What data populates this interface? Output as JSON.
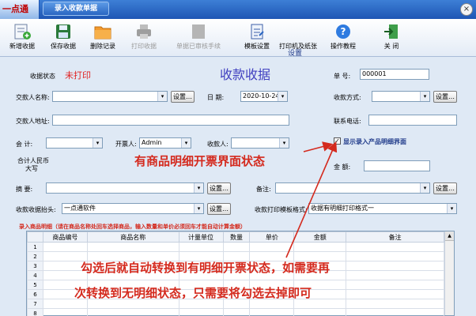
{
  "window": {
    "logo_text": "一点通",
    "title": "录入收款单据",
    "close_glyph": "×"
  },
  "toolbar": {
    "top_label": "设置",
    "buttons": [
      {
        "label": "新增收据",
        "icon": "new-receipt-icon",
        "enabled": true
      },
      {
        "label": "保存收据",
        "icon": "save-icon",
        "enabled": true
      },
      {
        "label": "删除记录",
        "icon": "delete-folder-icon",
        "enabled": true
      },
      {
        "label": "打印收据",
        "icon": "printer-icon",
        "enabled": false
      },
      {
        "label": "单据已审核手续",
        "icon": "audit-icon",
        "enabled": false
      },
      {
        "label": "模板设置",
        "icon": "template-icon",
        "enabled": true
      },
      {
        "label": "打印机及纸张",
        "icon": "printer-settings-icon",
        "enabled": true
      },
      {
        "label": "操作教程",
        "icon": "help-icon",
        "enabled": true
      },
      {
        "label": "关 闭",
        "icon": "exit-icon",
        "enabled": true
      }
    ]
  },
  "form": {
    "title": "收款收据",
    "status_label": "收据状态",
    "status_value": "未打印",
    "number_label": "单    号:",
    "number_value": "000001",
    "payer_label": "交款人名称:",
    "payer_value": "",
    "date_label": "日    期:",
    "date_value": "2020-10-24",
    "pay_method_label": "收款方式:",
    "pay_method_value": "",
    "payer_address_label": "交款人地址:",
    "payer_address_value": "",
    "phone_label": "联系电话:",
    "phone_value": "",
    "accountant_label": "会     计:",
    "accountant_value": "",
    "issuer_label": "开票人:",
    "issuer_value": "Admin",
    "receiver_label": "收款人:",
    "receiver_value": "",
    "show_detail_label": "显示录入产品明细界面",
    "show_detail_checked": true,
    "total_label_line1": "合计人民币",
    "total_label_line2": "大写",
    "amount_label": "金    额:",
    "amount_value": "",
    "summary_label": "摘     要:",
    "summary_value": "",
    "remark_label": "备注:",
    "remark_value": "",
    "receipt_header_label": "收款收据抬头:",
    "receipt_header_value": "一点通软件",
    "print_template_label": "收款打印模板格式:",
    "print_template_value": "收据有明细打印格式一",
    "setting_button": "设置…",
    "select_arrow": "▾"
  },
  "detail": {
    "caption": "录入商品明细（请在商品名称处回车选择商品，输入数量和单价必须回车才能自动计算金额）",
    "columns": [
      "商品编号",
      "商品名称",
      "计量单位",
      "数量",
      "单价",
      "金额",
      "备注"
    ],
    "rows": [
      "1",
      "2",
      "3",
      "4",
      "5",
      "6",
      "7",
      "8"
    ],
    "scroll_up_glyph": "▲"
  },
  "annotations": {
    "state_text": "有商品明细开票界面状态",
    "instruction_line1": "勾选后就自动转换到有明细开票状态，如需要再",
    "instruction_line2": "次转换到无明细状态，只需要将勾选去掉即可"
  },
  "colors": {
    "annotation": "#d42a1e",
    "title_bar": "#1e56b4",
    "form_bg": "#dfe9f5"
  }
}
